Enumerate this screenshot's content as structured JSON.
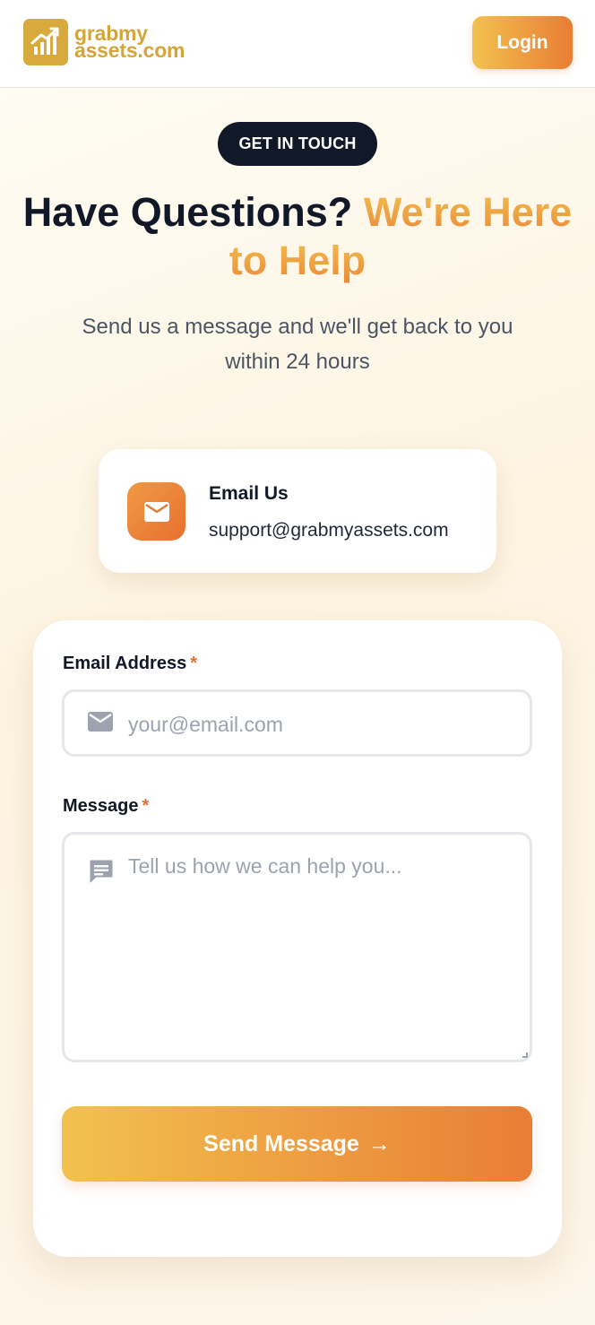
{
  "header": {
    "logo_line1": "grabmy",
    "logo_line2": "assets.com",
    "login_label": "Login",
    "brand_color": "#d4a53a"
  },
  "hero": {
    "badge": "GET IN TOUCH",
    "headline_dark": "Have Questions?",
    "headline_accent": "We're Here to Help",
    "subtitle": "Send us a message and we'll get back to you within 24 hours"
  },
  "contact_card": {
    "icon": "mail-icon",
    "title": "Email Us",
    "value": "support@grabmyassets.com"
  },
  "form": {
    "email_label": "Email Address",
    "email_required": "*",
    "email_icon": "mail-icon",
    "email_placeholder": "your@email.com",
    "message_label": "Message",
    "message_required": "*",
    "message_icon": "message-icon",
    "message_placeholder": "Tell us how we can help you...",
    "submit_label": "Send Message",
    "submit_arrow": "→"
  },
  "colors": {
    "accent_start": "#f2c14f",
    "accent_end": "#e97d35",
    "dark": "#111827"
  }
}
